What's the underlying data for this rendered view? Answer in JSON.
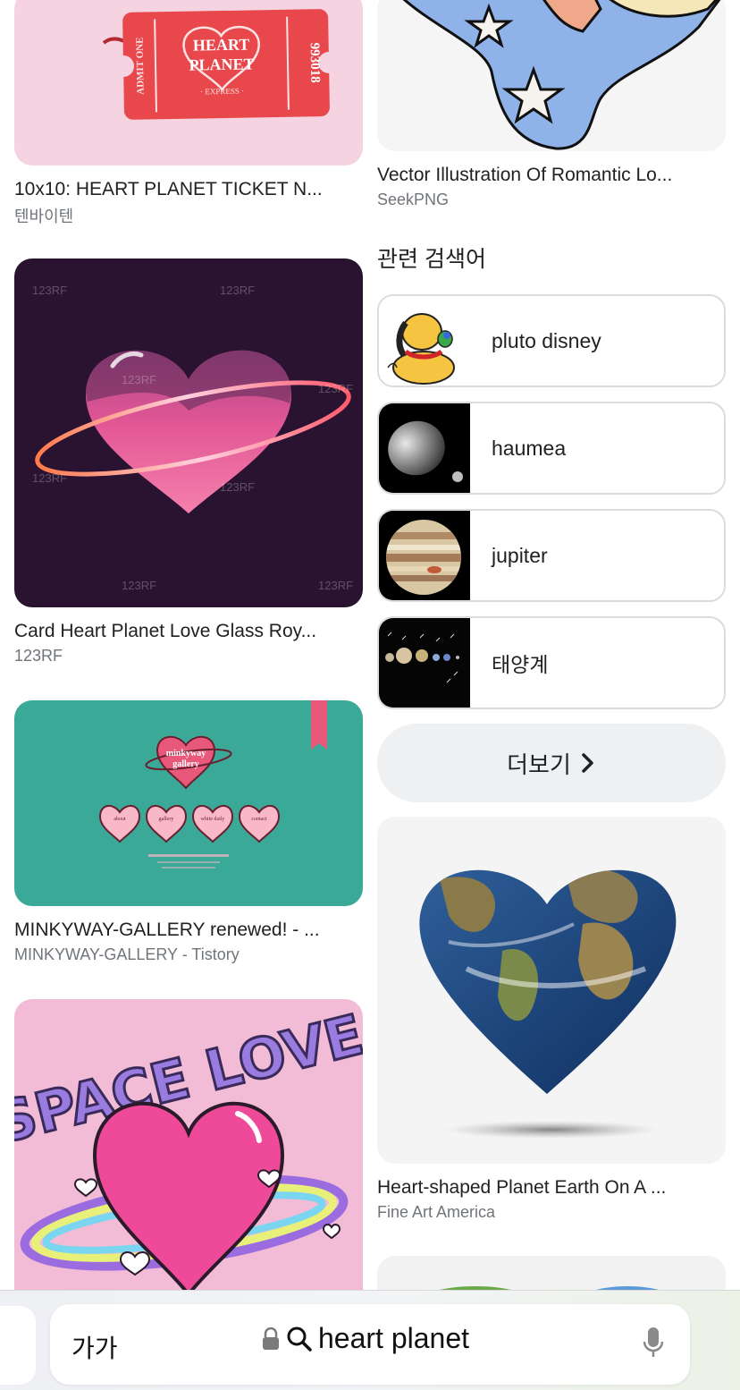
{
  "results_left": [
    {
      "title": "10x10: HEART PLANET TICKET N...",
      "source": "텐바이텐",
      "ticket": {
        "admit": "ADMIT ONE",
        "line1": "HEART",
        "line2": "PLANET",
        "sub": "· EXPRESS ·",
        "serial": "993018"
      }
    },
    {
      "title": "Card Heart Planet Love Glass Roy...",
      "source": "123RF",
      "watermark": "123RF"
    },
    {
      "title": "MINKYWAY-GALLERY renewed! - ...",
      "source": "MINKYWAY-GALLERY - Tistory",
      "logo_line1": "minkyway",
      "logo_line2": "gallery",
      "hearts": [
        "about",
        "gallery",
        "white daily",
        "contact"
      ]
    },
    {
      "title": "",
      "source": "",
      "art_text": "SPACE LOVE"
    }
  ],
  "results_right": [
    {
      "title": "Vector Illustration Of Romantic Lo...",
      "source": "SeekPNG"
    },
    {
      "title": "Heart-shaped Planet Earth On A ...",
      "source": "Fine Art America"
    }
  ],
  "related": {
    "heading": "관련 검색어",
    "items": [
      {
        "label": "pluto disney",
        "thumb": "pluto"
      },
      {
        "label": "haumea",
        "thumb": "haumea"
      },
      {
        "label": "jupiter",
        "thumb": "jupiter"
      },
      {
        "label": "태양계",
        "thumb": "solar-system"
      }
    ],
    "more_label": "더보기"
  },
  "address_bar": {
    "text_size_label": "가가",
    "query": "heart planet"
  },
  "colors": {
    "ticket_red": "#e8474c",
    "pink_bg": "#f6d3e0",
    "teal_bg": "#3aa998",
    "night_bg": "#2a1330",
    "sky_blue": "#8fb3e8"
  }
}
